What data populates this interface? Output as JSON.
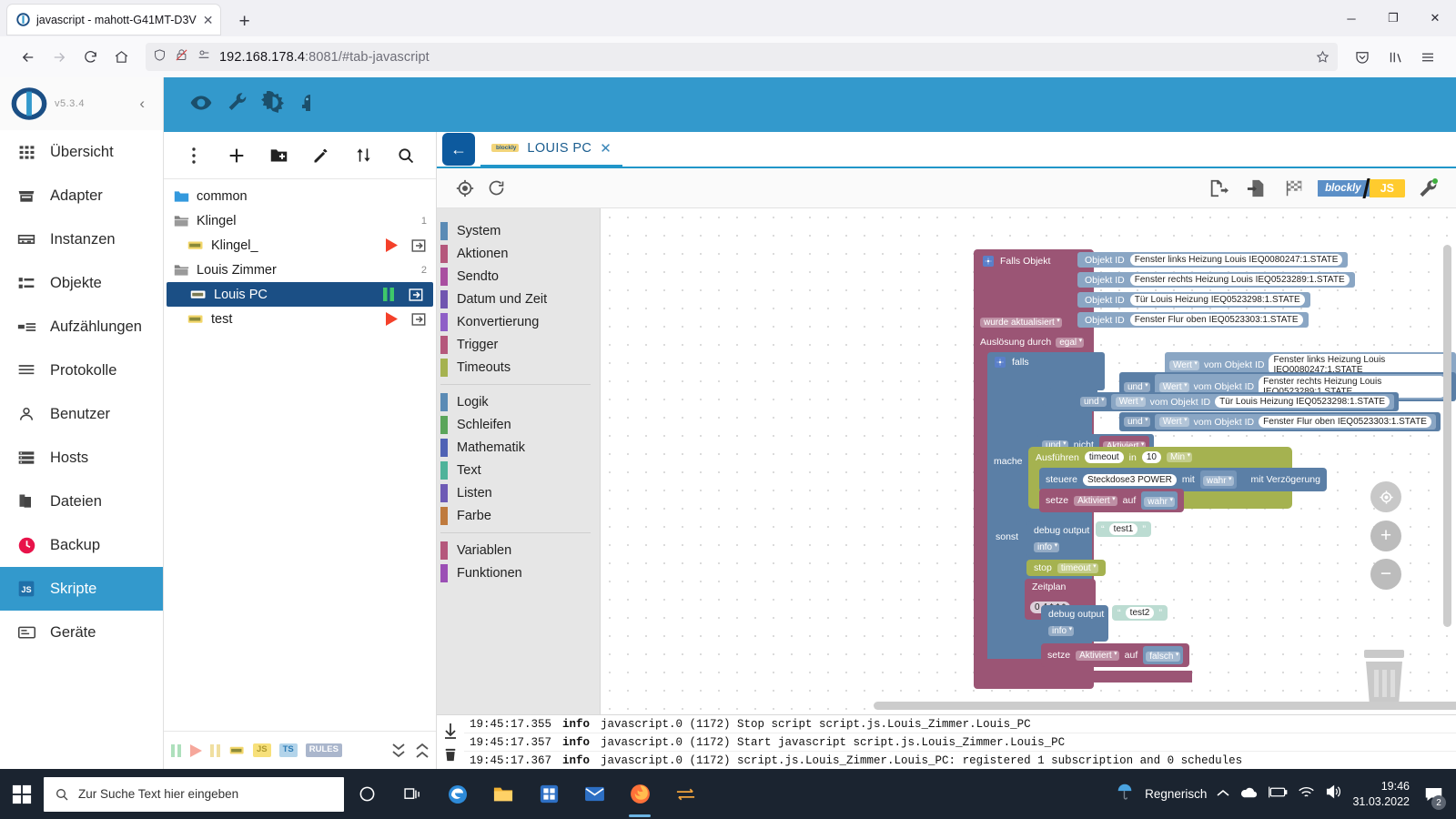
{
  "browser": {
    "tab_title": "javascript - mahott-G41MT-D3V",
    "tab_close": "✕",
    "new_tab": "+",
    "url_host": "192.168.178.4",
    "url_rest": ":8081/#tab-javascript",
    "minimize": "─",
    "maximize": "❐",
    "close": "✕"
  },
  "sidebar": {
    "version": "v5.3.4",
    "collapse": "‹",
    "items": [
      {
        "label": "Übersicht",
        "icon": "grid-icon"
      },
      {
        "label": "Adapter",
        "icon": "store-icon"
      },
      {
        "label": "Instanzen",
        "icon": "instances-icon"
      },
      {
        "label": "Objekte",
        "icon": "list-icon"
      },
      {
        "label": "Aufzählungen",
        "icon": "enum-icon"
      },
      {
        "label": "Protokolle",
        "icon": "lines-icon"
      },
      {
        "label": "Benutzer",
        "icon": "user-icon"
      },
      {
        "label": "Hosts",
        "icon": "server-icon"
      },
      {
        "label": "Dateien",
        "icon": "files-icon"
      },
      {
        "label": "Backup",
        "icon": "backup-icon"
      },
      {
        "label": "Skripte",
        "icon": "js-icon",
        "active": true
      },
      {
        "label": "Geräte",
        "icon": "device-icon"
      }
    ]
  },
  "apptoolbar": {
    "icons": [
      "eye-icon",
      "wrench-icon",
      "contrast-icon",
      "host-head-icon"
    ]
  },
  "tree": {
    "toolbar": [
      "more-vert-icon",
      "add-script-icon",
      "add-folder-icon",
      "edit-icon",
      "expand-collapse-icon",
      "search-icon"
    ],
    "rows": [
      {
        "label": "common",
        "type": "folder-open-blue",
        "indent": 0,
        "count": ""
      },
      {
        "label": "Klingel",
        "type": "folder",
        "indent": 0,
        "count": "1"
      },
      {
        "label": "Klingel_",
        "type": "script",
        "indent": 1,
        "state": "stopped",
        "count": ""
      },
      {
        "label": "Louis Zimmer",
        "type": "folder",
        "indent": 0,
        "count": "2"
      },
      {
        "label": "Louis PC",
        "type": "script",
        "indent": 1,
        "state": "running",
        "selected": true,
        "count": ""
      },
      {
        "label": "test",
        "type": "script",
        "indent": 1,
        "state": "stopped",
        "count": ""
      }
    ],
    "bottom_filters": [
      "pause-icon",
      "play-icon",
      "pause-alt-icon",
      "blockly-chip",
      "JS",
      "TS",
      "RULES"
    ],
    "bottom_right": [
      "collapse-all-icon",
      "expand-all-icon"
    ]
  },
  "editor": {
    "back": "←",
    "tab_label": "LOUIS PC",
    "tab_chip": "blockly",
    "tab_close": "✕",
    "toolbar_left": [
      "target-icon",
      "reload-icon"
    ],
    "toolbar_right": [
      "export-icon",
      "import-icon",
      "checkered-flag-icon",
      "settings-gear-icon"
    ],
    "toggle_blockly": "blockly",
    "toggle_js": "JS"
  },
  "toolbox": {
    "groups": [
      [
        {
          "label": "System",
          "color": "#5b8bb5"
        },
        {
          "label": "Aktionen",
          "color": "#b5587c"
        },
        {
          "label": "Sendto",
          "color": "#a94fa0"
        },
        {
          "label": "Datum und Zeit",
          "color": "#7055b0"
        },
        {
          "label": "Konvertierung",
          "color": "#8f5fc7"
        },
        {
          "label": "Trigger",
          "color": "#b5587c"
        },
        {
          "label": "Timeouts",
          "color": "#a5b250"
        }
      ],
      [
        {
          "label": "Logik",
          "color": "#5b8bb5"
        },
        {
          "label": "Schleifen",
          "color": "#5ba55b"
        },
        {
          "label": "Mathematik",
          "color": "#5063b5"
        },
        {
          "label": "Text",
          "color": "#4fb39a"
        },
        {
          "label": "Listen",
          "color": "#6e5bb5"
        },
        {
          "label": "Farbe",
          "color": "#bf7a3d"
        }
      ],
      [
        {
          "label": "Variablen",
          "color": "#b5587c"
        },
        {
          "label": "Funktionen",
          "color": "#9b4fb5"
        }
      ]
    ]
  },
  "blockly": {
    "trigger": {
      "title": "Falls Objekt",
      "objekt_id_label": "Objekt ID",
      "objects": [
        "Fenster links Heizung Louis IEQ0080247:1.STATE",
        "Fenster rechts Heizung Louis  IEQ0523289:1.STATE",
        "Tür Louis Heizung IEQ0523298:1.STATE",
        "Fenster Flur oben IEQ0523303:1.STATE"
      ],
      "changed": "wurde aktualisiert",
      "trigger_by_label": "Auslösung durch",
      "trigger_by_value": "egal"
    },
    "if": {
      "label": "falls",
      "and": "und",
      "not": "nicht",
      "value": "Wert",
      "from_object": "vom Objekt ID",
      "conditions": [
        "Fenster links Heizung Louis IEQ0080247:1.STATE",
        "Fenster rechts Heizung Louis  IEQ0523289:1.STATE",
        "Tür Louis Heizung IEQ0523298:1.STATE",
        "Fenster Flur oben IEQ0523303:1.STATE"
      ],
      "not_var": "Aktiviert"
    },
    "do": {
      "label": "mache",
      "timeout_run": "Ausführen",
      "timeout_name": "timeout",
      "in": "in",
      "delay_value": "10",
      "delay_unit": "Min",
      "control": "steuere",
      "control_target": "Steckdose3 POWER",
      "with": "mit",
      "control_value": "wahr",
      "with_delay": "mit Verzögerung",
      "set": "setze",
      "set_var": "Aktiviert",
      "auf": "auf",
      "set_value": "wahr"
    },
    "else": {
      "label": "sonst",
      "debug1": "debug output",
      "debug1_text": "test1",
      "debug1_level": "info",
      "stop": "stop",
      "stop_target": "timeout",
      "schedule": "Zeitplan",
      "schedule_value": "0 4 * * *",
      "debug2": "debug output",
      "debug2_text": "test2",
      "debug2_level": "info",
      "set": "setze",
      "set_var": "Aktiviert",
      "auf": "auf",
      "set_value": "falsch",
      "quote_open": "“",
      "quote_close": "”"
    }
  },
  "log": {
    "lines": [
      {
        "ts": "19:45:17.355",
        "level": "info",
        "msg": "javascript.0 (1172) Stop script script.js.Louis_Zimmer.Louis_PC"
      },
      {
        "ts": "19:45:17.357",
        "level": "info",
        "msg": "javascript.0 (1172) Start javascript script.js.Louis_Zimmer.Louis_PC"
      },
      {
        "ts": "19:45:17.367",
        "level": "info",
        "msg": "javascript.0 (1172) script.js.Louis_Zimmer.Louis_PC: registered 1 subscription and 0 schedules"
      }
    ]
  },
  "taskbar": {
    "search_placeholder": "Zur Suche Text hier eingeben",
    "weather": "Regnerisch",
    "time": "19:46",
    "date": "31.03.2022",
    "notif_count": "2"
  }
}
